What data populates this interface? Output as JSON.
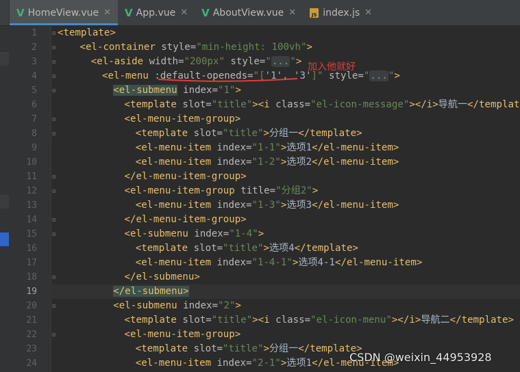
{
  "tabs": [
    {
      "label": "HomeView.vue",
      "icon": "vue-icon",
      "active": true
    },
    {
      "label": "App.vue",
      "icon": "vue-icon",
      "active": false
    },
    {
      "label": "AboutView.vue",
      "icon": "vue-icon",
      "active": false
    },
    {
      "label": "index.js",
      "icon": "js-icon",
      "active": false
    }
  ],
  "editor": {
    "current_line": 19,
    "lines": [
      {
        "n": 1,
        "indent": 0,
        "parts": [
          [
            "t",
            "<template>"
          ]
        ]
      },
      {
        "n": 2,
        "indent": 2,
        "parts": [
          [
            "t",
            "<el-container "
          ],
          [
            "a",
            "style="
          ],
          [
            "s",
            "\"min-height: 100vh\""
          ],
          [
            "t",
            ">"
          ]
        ]
      },
      {
        "n": 3,
        "indent": 3,
        "parts": [
          [
            "t",
            "<el-aside "
          ],
          [
            "a",
            "width="
          ],
          [
            "s",
            "\"200px\" "
          ],
          [
            "a",
            "style="
          ],
          [
            "s",
            "\""
          ],
          [
            "f",
            "..."
          ],
          [
            "s",
            "\""
          ],
          [
            "t",
            ">"
          ]
        ]
      },
      {
        "n": 4,
        "indent": 4,
        "parts": [
          [
            "t",
            "<el-menu "
          ],
          [
            "a",
            ":default-openeds="
          ],
          [
            "s",
            "\"["
          ],
          [
            "tx",
            "'1', '3'"
          ],
          [
            "s",
            "]\" "
          ],
          [
            "a",
            "style="
          ],
          [
            "s",
            "\""
          ],
          [
            "f",
            "..."
          ],
          [
            "s",
            "\""
          ],
          [
            "t",
            ">"
          ]
        ]
      },
      {
        "n": 5,
        "indent": 5,
        "parts": [
          [
            "h",
            "<el-submenu"
          ],
          [
            "t",
            " "
          ],
          [
            "a",
            "index="
          ],
          [
            "s",
            "\"1\""
          ],
          [
            "t",
            ">"
          ]
        ]
      },
      {
        "n": 6,
        "indent": 6,
        "parts": [
          [
            "t",
            "<template "
          ],
          [
            "a",
            "slot="
          ],
          [
            "s",
            "\"title\""
          ],
          [
            "t",
            ">"
          ],
          [
            "t",
            "<i "
          ],
          [
            "a",
            "class="
          ],
          [
            "s",
            "\"el-icon-message\""
          ],
          [
            "t",
            "></i>"
          ],
          [
            "tx",
            "导航一"
          ],
          [
            "t",
            "</template>"
          ]
        ]
      },
      {
        "n": 7,
        "indent": 6,
        "parts": [
          [
            "t",
            "<el-menu-item-group>"
          ]
        ]
      },
      {
        "n": 8,
        "indent": 7,
        "parts": [
          [
            "t",
            "<template "
          ],
          [
            "a",
            "slot="
          ],
          [
            "s",
            "\"title\""
          ],
          [
            "t",
            ">"
          ],
          [
            "tx",
            "分组一"
          ],
          [
            "t",
            "</template>"
          ]
        ]
      },
      {
        "n": 9,
        "indent": 7,
        "parts": [
          [
            "t",
            "<el-menu-item "
          ],
          [
            "a",
            "index="
          ],
          [
            "s",
            "\"1-1\""
          ],
          [
            "t",
            ">"
          ],
          [
            "tx",
            "选项1"
          ],
          [
            "t",
            "</el-menu-item>"
          ]
        ]
      },
      {
        "n": 10,
        "indent": 7,
        "parts": [
          [
            "t",
            "<el-menu-item "
          ],
          [
            "a",
            "index="
          ],
          [
            "s",
            "\"1-2\""
          ],
          [
            "t",
            ">"
          ],
          [
            "tx",
            "选项2"
          ],
          [
            "t",
            "</el-menu-item>"
          ]
        ]
      },
      {
        "n": 11,
        "indent": 6,
        "parts": [
          [
            "t",
            "</el-menu-item-group>"
          ]
        ]
      },
      {
        "n": 12,
        "indent": 6,
        "parts": [
          [
            "t",
            "<el-menu-item-group "
          ],
          [
            "a",
            "title="
          ],
          [
            "s",
            "\"分组2\""
          ],
          [
            "t",
            ">"
          ]
        ]
      },
      {
        "n": 13,
        "indent": 7,
        "parts": [
          [
            "t",
            "<el-menu-item "
          ],
          [
            "a",
            "index="
          ],
          [
            "s",
            "\"1-3\""
          ],
          [
            "t",
            ">"
          ],
          [
            "tx",
            "选项3"
          ],
          [
            "t",
            "</el-menu-item>"
          ]
        ]
      },
      {
        "n": 14,
        "indent": 6,
        "parts": [
          [
            "t",
            "</el-menu-item-group>"
          ]
        ]
      },
      {
        "n": 15,
        "indent": 6,
        "parts": [
          [
            "t",
            "<el-submenu "
          ],
          [
            "a",
            "index="
          ],
          [
            "s",
            "\"1-4\""
          ],
          [
            "t",
            ">"
          ]
        ]
      },
      {
        "n": 16,
        "indent": 7,
        "parts": [
          [
            "t",
            "<template "
          ],
          [
            "a",
            "slot="
          ],
          [
            "s",
            "\"title\""
          ],
          [
            "t",
            ">"
          ],
          [
            "tx",
            "选项4"
          ],
          [
            "t",
            "</template>"
          ]
        ]
      },
      {
        "n": 17,
        "indent": 7,
        "parts": [
          [
            "t",
            "<el-menu-item "
          ],
          [
            "a",
            "index="
          ],
          [
            "s",
            "\"1-4-1\""
          ],
          [
            "t",
            ">"
          ],
          [
            "tx",
            "选项4-1"
          ],
          [
            "t",
            "</el-menu-item>"
          ]
        ]
      },
      {
        "n": 18,
        "indent": 6,
        "parts": [
          [
            "t",
            "</el-submenu>"
          ]
        ]
      },
      {
        "n": 19,
        "indent": 5,
        "parts": [
          [
            "h",
            "</el-submenu>"
          ]
        ]
      },
      {
        "n": 20,
        "indent": 5,
        "parts": [
          [
            "t",
            "<el-submenu "
          ],
          [
            "a",
            "index="
          ],
          [
            "s",
            "\"2\""
          ],
          [
            "t",
            ">"
          ]
        ]
      },
      {
        "n": 21,
        "indent": 6,
        "parts": [
          [
            "t",
            "<template "
          ],
          [
            "a",
            "slot="
          ],
          [
            "s",
            "\"title\""
          ],
          [
            "t",
            ">"
          ],
          [
            "t",
            "<i "
          ],
          [
            "a",
            "class="
          ],
          [
            "s",
            "\"el-icon-menu\""
          ],
          [
            "t",
            "></i>"
          ],
          [
            "tx",
            "导航二"
          ],
          [
            "t",
            "</template>"
          ]
        ]
      },
      {
        "n": 22,
        "indent": 6,
        "parts": [
          [
            "t",
            "<el-menu-item-group>"
          ]
        ]
      },
      {
        "n": 23,
        "indent": 7,
        "parts": [
          [
            "t",
            "<template "
          ],
          [
            "a",
            "slot="
          ],
          [
            "s",
            "\"title\""
          ],
          [
            "t",
            ">"
          ],
          [
            "tx",
            "分组一"
          ],
          [
            "t",
            "</template>"
          ]
        ]
      },
      {
        "n": 24,
        "indent": 7,
        "parts": [
          [
            "t",
            "<el-menu-item "
          ],
          [
            "a",
            "index="
          ],
          [
            "s",
            "\"2-1\""
          ],
          [
            "t",
            ">"
          ],
          [
            "tx",
            "选项1"
          ],
          [
            "t",
            "</el-menu-item>"
          ]
        ]
      }
    ]
  },
  "annotation": {
    "text": "加入他就好",
    "color": "#e63b3b"
  },
  "watermark": "CSDN @weixin_44953928",
  "colors": {
    "tag": "#e8bf6a",
    "attr": "#bababa",
    "string": "#6a8759",
    "text": "#a9b7c6",
    "background": "#2b2b2b",
    "line_number": "#606366"
  }
}
